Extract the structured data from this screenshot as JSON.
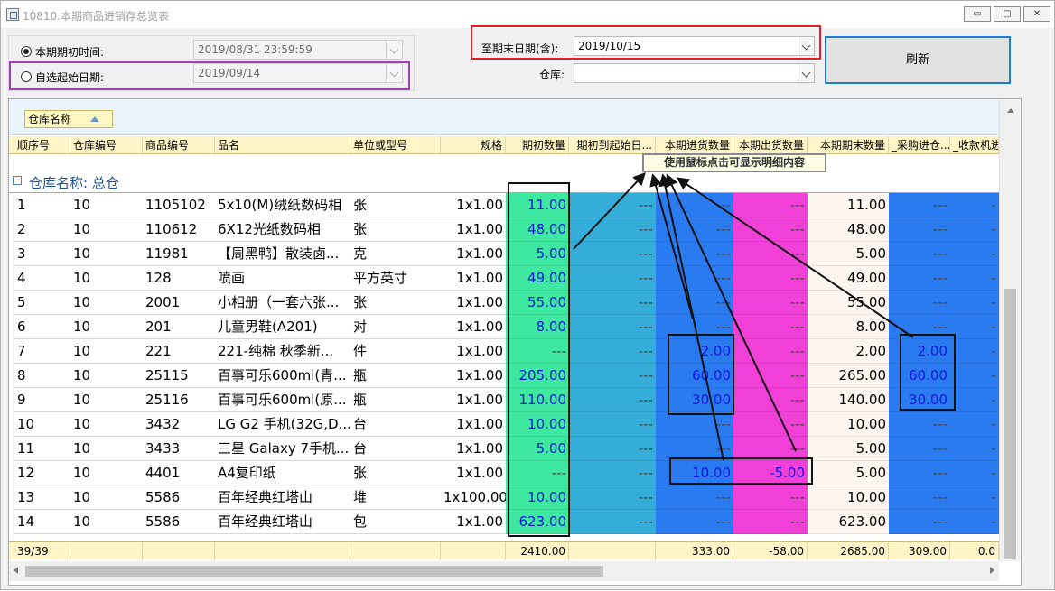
{
  "window": {
    "title": "10810.本期商品进销存总览表",
    "minimize_glyph": "▭",
    "maximize_glyph": "▢",
    "close_glyph": "✕"
  },
  "filters": {
    "opening_time_label": "本期期初时间:",
    "opening_time_value": "2019/08/31 23:59:59",
    "custom_start_label": "自选起始日期:",
    "custom_start_value": "2019/09/14",
    "end_date_label": "至期末日期(含):",
    "end_date_value": "2019/10/15",
    "warehouse_label": "仓库:",
    "warehouse_value": "",
    "refresh_label": "刷新",
    "selected_radio": "opening"
  },
  "grid": {
    "group_chip_label": "仓库名称",
    "columns": [
      "顺序号",
      "仓库编号",
      "商品编号",
      "品名",
      "单位或型号",
      "规格",
      "期初数量",
      "期初到起始日...",
      "本期进货数量",
      "本期出货数量",
      "本期期末数量",
      "_采购进仓...",
      "_收款机进"
    ],
    "group_label": "仓库名称: 总仓",
    "rows": [
      [
        "1",
        "10",
        "1105102",
        "5x10(M)绒纸数码相",
        "张",
        "1x1.00",
        "11.00",
        "---",
        "---",
        "---",
        "11.00",
        "---",
        "-"
      ],
      [
        "2",
        "10",
        "110612",
        "6X12光纸数码相",
        "张",
        "1x1.00",
        "48.00",
        "---",
        "---",
        "---",
        "48.00",
        "---",
        "-"
      ],
      [
        "3",
        "10",
        "11981",
        "【周黑鸭】散装卤...",
        "克",
        "1x1.00",
        "5.00",
        "---",
        "---",
        "---",
        "5.00",
        "---",
        "-"
      ],
      [
        "4",
        "10",
        "128",
        "喷画",
        "平方英寸",
        "1x1.00",
        "49.00",
        "---",
        "---",
        "---",
        "49.00",
        "---",
        "-"
      ],
      [
        "5",
        "10",
        "2001",
        "小相册（一套六张...",
        "张",
        "1x1.00",
        "55.00",
        "---",
        "---",
        "---",
        "55.00",
        "---",
        "-"
      ],
      [
        "6",
        "10",
        "201",
        "儿童男鞋(A201)",
        "对",
        "1x1.00",
        "8.00",
        "---",
        "---",
        "---",
        "8.00",
        "---",
        "-"
      ],
      [
        "7",
        "10",
        "221",
        "221-纯棉 秋季新...",
        "件",
        "1x1.00",
        "---",
        "---",
        "2.00",
        "---",
        "2.00",
        "2.00",
        "-"
      ],
      [
        "8",
        "10",
        "25115",
        "百事可乐600ml(青...",
        "瓶",
        "1x1.00",
        "205.00",
        "---",
        "60.00",
        "---",
        "265.00",
        "60.00",
        "-"
      ],
      [
        "9",
        "10",
        "25116",
        "百事可乐600ml(原...",
        "瓶",
        "1x1.00",
        "110.00",
        "---",
        "30.00",
        "---",
        "140.00",
        "30.00",
        "-"
      ],
      [
        "10",
        "10",
        "3432",
        "LG G2 手机(32G,D...",
        "台",
        "1x1.00",
        "10.00",
        "---",
        "---",
        "---",
        "10.00",
        "---",
        "-"
      ],
      [
        "11",
        "10",
        "3433",
        "三星 Galaxy 7手机...",
        "台",
        "1x1.00",
        "5.00",
        "---",
        "---",
        "---",
        "5.00",
        "---",
        "-"
      ],
      [
        "12",
        "10",
        "4401",
        "A4复印纸",
        "张",
        "1x1.00",
        "---",
        "---",
        "10.00",
        "-5.00",
        "5.00",
        "---",
        "-"
      ],
      [
        "13",
        "10",
        "5586",
        "百年经典红塔山",
        "堆",
        "1x100.00",
        "10.00",
        "---",
        "---",
        "---",
        "10.00",
        "---",
        "-"
      ],
      [
        "14",
        "10",
        "5586",
        "百年经典红塔山",
        "包",
        "1x1.00",
        "623.00",
        "---",
        "---",
        "---",
        "623.00",
        "---",
        "-"
      ]
    ],
    "summary": [
      "39/39",
      "",
      "",
      "",
      "",
      "",
      "2410.00",
      "",
      "333.00",
      "-58.00",
      "2685.00",
      "309.00",
      "0.0"
    ],
    "tooltip": "使用鼠标点击可显示明细内容",
    "colors": {
      "opening_col": "#3ee8a0",
      "begin_to_start_col": "#34aed8",
      "purchase_col": "#2a7af0",
      "shipment_col": "#f040d8",
      "ending_col": "#fdf6f0",
      "purchase_in_col": "#2a7af0",
      "value_text": "#1515e0",
      "annotation_red": "#e02020",
      "annotation_purple": "#a040c0",
      "annotation_black": "#111111"
    }
  }
}
